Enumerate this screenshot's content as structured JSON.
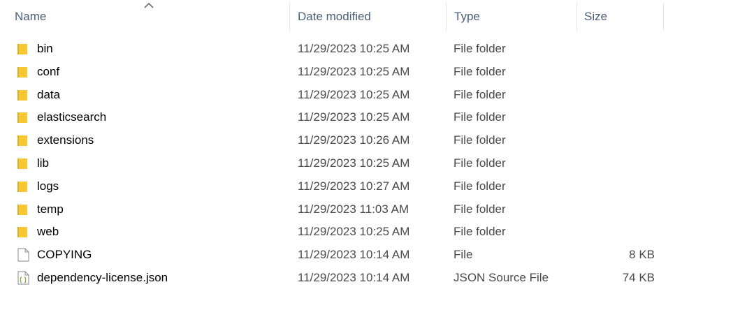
{
  "header": {
    "columns": {
      "name": "Name",
      "date": "Date modified",
      "type": "Type",
      "size": "Size"
    },
    "sort_icon": "sort-ascending-chevron-icon"
  },
  "colors": {
    "folder": "#f8c832",
    "header_text": "#4c607a",
    "json_icon_accent": "#76b041"
  },
  "files": [
    {
      "name": "bin",
      "date": "11/29/2023 10:25 AM",
      "type": "File folder",
      "size": "",
      "icon": "folder-icon"
    },
    {
      "name": "conf",
      "date": "11/29/2023 10:25 AM",
      "type": "File folder",
      "size": "",
      "icon": "folder-icon"
    },
    {
      "name": "data",
      "date": "11/29/2023 10:25 AM",
      "type": "File folder",
      "size": "",
      "icon": "folder-icon"
    },
    {
      "name": "elasticsearch",
      "date": "11/29/2023 10:25 AM",
      "type": "File folder",
      "size": "",
      "icon": "folder-icon"
    },
    {
      "name": "extensions",
      "date": "11/29/2023 10:26 AM",
      "type": "File folder",
      "size": "",
      "icon": "folder-icon"
    },
    {
      "name": "lib",
      "date": "11/29/2023 10:25 AM",
      "type": "File folder",
      "size": "",
      "icon": "folder-icon"
    },
    {
      "name": "logs",
      "date": "11/29/2023 10:27 AM",
      "type": "File folder",
      "size": "",
      "icon": "folder-icon"
    },
    {
      "name": "temp",
      "date": "11/29/2023 11:03 AM",
      "type": "File folder",
      "size": "",
      "icon": "folder-icon"
    },
    {
      "name": "web",
      "date": "11/29/2023 10:25 AM",
      "type": "File folder",
      "size": "",
      "icon": "folder-icon"
    },
    {
      "name": "COPYING",
      "date": "11/29/2023 10:14 AM",
      "type": "File",
      "size": "8 KB",
      "icon": "file-icon"
    },
    {
      "name": "dependency-license.json",
      "date": "11/29/2023 10:14 AM",
      "type": "JSON Source File",
      "size": "74 KB",
      "icon": "json-file-icon"
    }
  ]
}
